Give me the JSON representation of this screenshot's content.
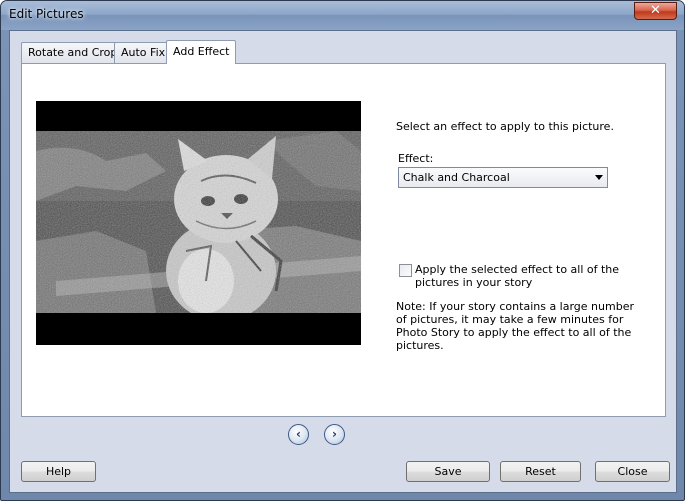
{
  "window": {
    "title": "Edit Pictures",
    "close_glyph": "✕"
  },
  "tabs": [
    {
      "label": "Rotate and Crop"
    },
    {
      "label": "Auto Fix"
    },
    {
      "label": "Add Effect",
      "active": true
    }
  ],
  "panel": {
    "instruction": "Select an effect to apply to this picture.",
    "effect_label": "Effect:",
    "effect_selected": "Chalk and Charcoal",
    "apply_all_label": "Apply the selected effect to all of the pictures in your story",
    "apply_all_checked": false,
    "note": "Note: If your story contains a large number of pictures, it may take a few minutes for Photo Story to apply the effect to all of the pictures."
  },
  "nav": {
    "prev_glyph": "‹",
    "next_glyph": "›"
  },
  "buttons": {
    "help": "Help",
    "save": "Save",
    "reset": "Reset",
    "close": "Close"
  },
  "colors": {
    "title_bar": "#8ea7c9",
    "client_bg": "#d6dbe9",
    "close_red": "#c0391f"
  }
}
